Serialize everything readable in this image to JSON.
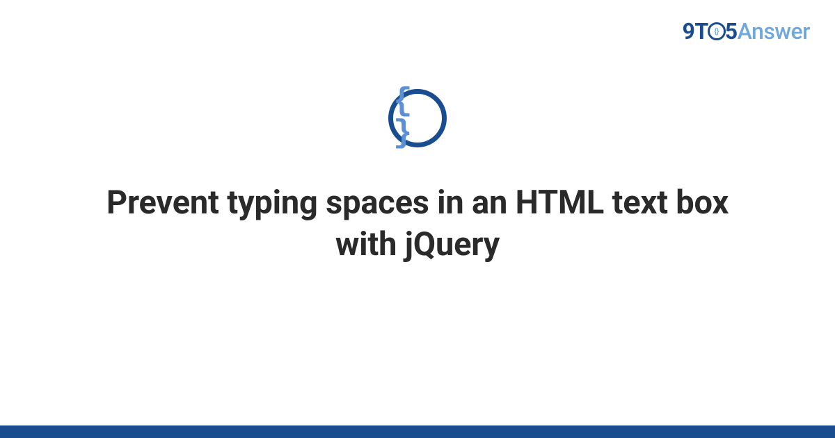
{
  "logo": {
    "part1": "9T",
    "inner": "{}",
    "part2": "5",
    "part3": "Answer"
  },
  "category": {
    "icon_glyph": "{ }",
    "name": "code"
  },
  "title": "Prevent typing spaces in an HTML text box with jQuery",
  "colors": {
    "brand_dark": "#1a4d8f",
    "brand_light": "#6fa8dc",
    "brace_blue": "#5b8fd6",
    "text": "#2a2a2a"
  }
}
